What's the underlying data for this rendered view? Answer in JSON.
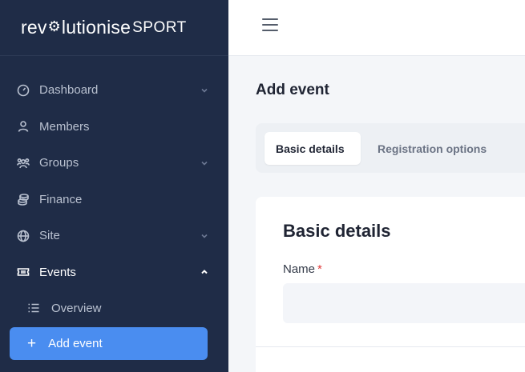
{
  "brand": {
    "logo_main": "rev",
    "logo_gear": "⚙",
    "logo_rest": "lutionise",
    "logo_sport": "SPORT"
  },
  "sidebar": {
    "items": [
      {
        "label": "Dashboard",
        "icon": "dashboard-gauge-icon",
        "has_chevron": true
      },
      {
        "label": "Members",
        "icon": "person-icon",
        "has_chevron": false
      },
      {
        "label": "Groups",
        "icon": "people-group-icon",
        "has_chevron": true
      },
      {
        "label": "Finance",
        "icon": "coins-icon",
        "has_chevron": false
      },
      {
        "label": "Site",
        "icon": "globe-icon",
        "has_chevron": true
      },
      {
        "label": "Events",
        "icon": "ticket-icon",
        "has_chevron": true,
        "expanded": true
      }
    ],
    "sub_items": [
      {
        "label": "Overview",
        "icon": "list-icon"
      },
      {
        "label": "Add event",
        "icon": "plus-icon",
        "active": true
      }
    ]
  },
  "topbar": {
    "menu_icon": "hamburger-icon"
  },
  "main": {
    "page_title": "Add event",
    "tabs": [
      {
        "label": "Basic details",
        "active": true
      },
      {
        "label": "Registration options",
        "active": false
      }
    ],
    "card": {
      "title": "Basic details",
      "name_label": "Name",
      "required_mark": "*",
      "name_value": "",
      "name_placeholder": ""
    }
  },
  "colors": {
    "sidebar_bg": "#1f2c47",
    "accent": "#4a8df0",
    "required": "#e03a3a",
    "content_bg": "#f4f6f9"
  }
}
